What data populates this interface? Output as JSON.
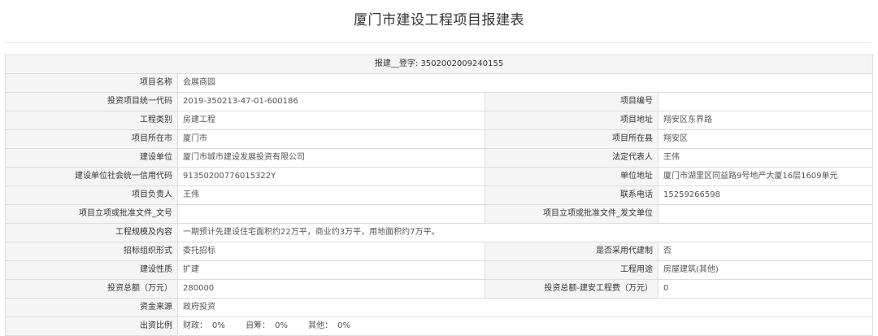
{
  "page_title": "厦门市建设工程项目报建表",
  "reg_line": "报建__登字: 3502002009240155",
  "fields": {
    "project_name": {
      "label": "项目名称",
      "value": "会展商园"
    },
    "unified_code": {
      "label": "投资项目统一代码",
      "value": "2019-350213-47-01-600186"
    },
    "project_number": {
      "label": "项目编号",
      "value": ""
    },
    "project_type": {
      "label": "工程类别",
      "value": "房建工程"
    },
    "project_address": {
      "label": "项目地址",
      "value": "翔安区东界路"
    },
    "city": {
      "label": "项目所在市",
      "value": "厦门市"
    },
    "county": {
      "label": "项目所在县",
      "value": "翔安区"
    },
    "builder": {
      "label": "建设单位",
      "value": "厦门市城市建设发展投资有限公司"
    },
    "legal_rep": {
      "label": "法定代表人",
      "value": "王伟"
    },
    "credit_code": {
      "label": "建设单位社会统一信用代码",
      "value": "91350200776015322Y"
    },
    "unit_address": {
      "label": "单位地址",
      "value": "厦门市湖里区同益路9号地产大厦16层1609单元"
    },
    "project_leader": {
      "label": "项目负责人",
      "value": "王伟"
    },
    "phone": {
      "label": "联系电话",
      "value": "15259266598"
    },
    "approval_doc_no": {
      "label": "项目立项或批准文件_文号",
      "value": ""
    },
    "approval_doc_unit": {
      "label": "项目立项或批准文件_发文单位",
      "value": ""
    },
    "scale_content": {
      "label": "工程规模及内容",
      "value": "一期预计先建设住宅面积约22万平，商业约3万平，用地面积约7万平。"
    },
    "tender_form": {
      "label": "招标组织形式",
      "value": "委托招标"
    },
    "agent_system": {
      "label": "是否采用代建制",
      "value": "否"
    },
    "build_nature": {
      "label": "建设性质",
      "value": "扩建"
    },
    "project_use": {
      "label": "工程用途",
      "value": "房屋建筑(其他)"
    },
    "total_investment": {
      "label": "投资总额（万元）",
      "value": "280000"
    },
    "construction_fee": {
      "label": "投资总额-建安工程费（万元）",
      "value": "0"
    },
    "fund_source": {
      "label": "资金来源",
      "value": "政府投资"
    },
    "funding_ratio": {
      "label": "出资比例",
      "items": [
        {
          "label": "财政：",
          "value": "0%"
        },
        {
          "label": "自筹：",
          "value": "0%"
        },
        {
          "label": "其他：",
          "value": "0%"
        }
      ]
    }
  }
}
